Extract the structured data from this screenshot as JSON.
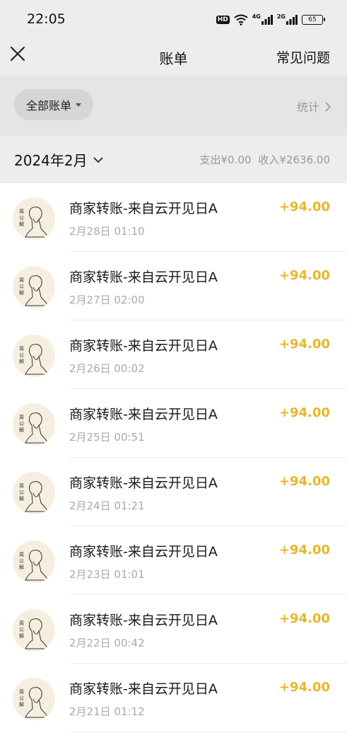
{
  "status": {
    "time": "22:05",
    "hd": "HD",
    "net1": "4G",
    "net2": "2G",
    "battery": "65"
  },
  "nav": {
    "title": "账单",
    "faq": "常见问题"
  },
  "filter": {
    "label": "全部账单",
    "stats": "统计"
  },
  "month": {
    "label": "2024年2月",
    "expense": "支出¥0.00",
    "income": "收入¥2636.00"
  },
  "colors": {
    "amount": "#e8b629",
    "background": "#ededed"
  },
  "transactions": [
    {
      "title": "商家转账-来自云开见日A",
      "time": "2月28日 01:10",
      "amount": "+94.00"
    },
    {
      "title": "商家转账-来自云开见日A",
      "time": "2月27日 02:00",
      "amount": "+94.00"
    },
    {
      "title": "商家转账-来自云开见日A",
      "time": "2月26日 00:02",
      "amount": "+94.00"
    },
    {
      "title": "商家转账-来自云开见日A",
      "time": "2月25日 00:51",
      "amount": "+94.00"
    },
    {
      "title": "商家转账-来自云开见日A",
      "time": "2月24日 01:21",
      "amount": "+94.00"
    },
    {
      "title": "商家转账-来自云开见日A",
      "time": "2月23日 01:01",
      "amount": "+94.00"
    },
    {
      "title": "商家转账-来自云开见日A",
      "time": "2月22日 00:42",
      "amount": "+94.00"
    },
    {
      "title": "商家转账-来自云开见日A",
      "time": "2月21日 01:12",
      "amount": "+94.00"
    }
  ]
}
